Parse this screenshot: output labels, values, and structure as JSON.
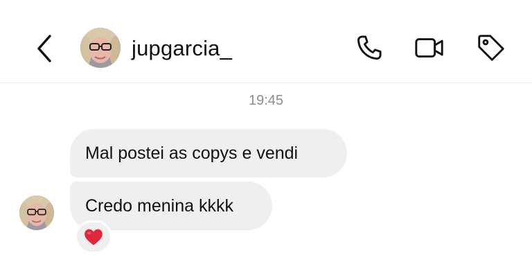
{
  "header": {
    "username": "jupgarcia_",
    "icons": {
      "back": "chevron-left-icon",
      "call": "phone-icon",
      "video": "video-camera-icon",
      "tag": "tag-icon"
    }
  },
  "conversation": {
    "timestamp": "19:45",
    "messages": [
      {
        "text": "Mal postei as copys e vendi",
        "sender": "jupgarcia_"
      },
      {
        "text": "Credo menina kkkk",
        "sender": "jupgarcia_",
        "reaction": "heart-icon"
      }
    ]
  },
  "colors": {
    "bubble": "#efefef",
    "timestamp": "#8e8e8e",
    "heart": "#e0283c",
    "divider": "#ececec"
  }
}
